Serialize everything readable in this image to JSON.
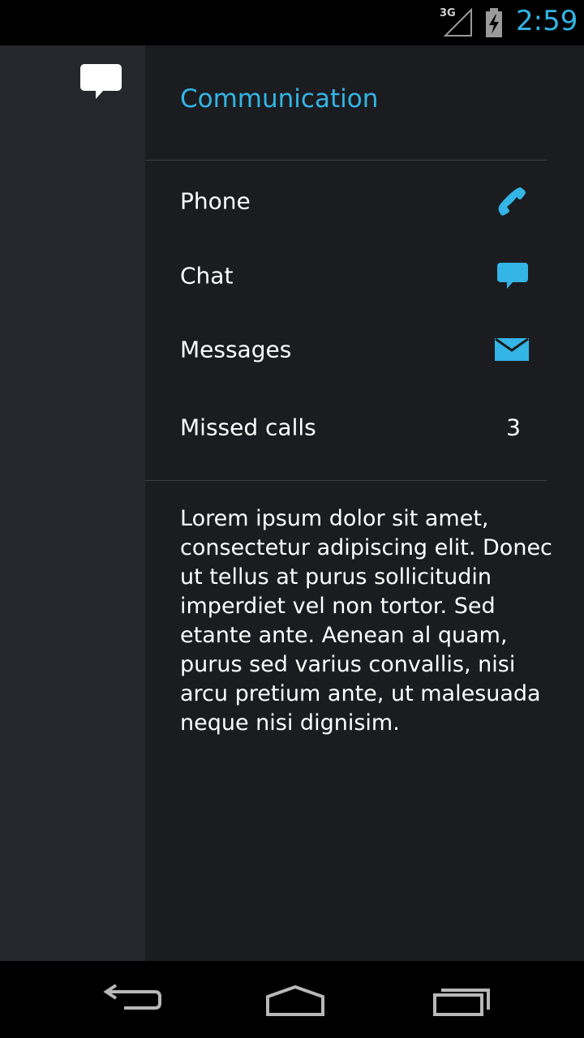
{
  "status_bar": {
    "network_label": "3G",
    "time": "2:59"
  },
  "side_rail": {
    "icon": "chat-bubble-icon"
  },
  "main": {
    "section_title": "Communication",
    "items": [
      {
        "label": "Phone",
        "icon": "phone-icon"
      },
      {
        "label": "Chat",
        "icon": "chat-icon"
      },
      {
        "label": "Messages",
        "icon": "mail-icon"
      },
      {
        "label": "Missed calls",
        "count": "3"
      }
    ],
    "body_text": "Lorem ipsum dolor sit amet,\nconsectetur adipiscing elit. Donec\nut tellus at purus sollicitudin\nimperdiet vel non tortor. Sed\netante ante. Aenean al quam,\npurus sed varius convallis, nisi\narcu pretium ante, ut malesuada\nneque nisi dignisim."
  },
  "nav_bar": {
    "buttons": [
      "back-icon",
      "home-icon",
      "recents-icon"
    ]
  },
  "colors": {
    "accent": "#33b5e5",
    "background": "#1b1c20",
    "rail": "#25272c"
  }
}
